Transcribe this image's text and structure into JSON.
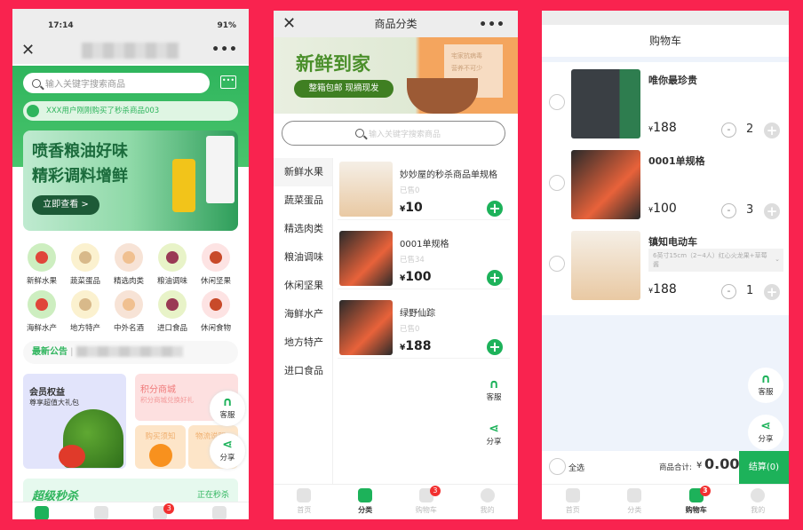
{
  "colors": {
    "background": "#f9234f",
    "brand_green": "#1db25a",
    "badge_red": "#f23030"
  },
  "home": {
    "status": {
      "time": "17:14",
      "battery": "91%"
    },
    "search_placeholder": "输入关键字搜索商品",
    "notice": "XXX用户刚刚购买了秒杀商品003",
    "banner": {
      "line1": "喷香粮油好味",
      "line2": "精彩调料增鲜",
      "cta": "立即查看 >"
    },
    "categories": [
      "新鲜水果",
      "蔬菜蛋品",
      "精选肉类",
      "粮油调味",
      "休闲坚果",
      "海鲜水产",
      "地方特产",
      "中外名酒",
      "进口食品",
      "休闲食物"
    ],
    "announcement_label": "最新公告",
    "member": {
      "title": "会员权益",
      "subtitle": "尊享超值大礼包"
    },
    "points": {
      "title": "积分商城",
      "subtitle": "积分商城兑换好礼"
    },
    "purchase_notice": "购买须知",
    "logistics": "物流说明",
    "flash": {
      "title": "超级秒杀",
      "status": "正在秒杀"
    },
    "cart_badge": "3"
  },
  "category_page": {
    "title": "商品分类",
    "banner": {
      "title": "新鲜到家",
      "subtitle": "整箱包邮 现摘现发",
      "side1": "宅家抗病毒",
      "side2": "营养不可少"
    },
    "search_placeholder": "输入关键字搜索商品",
    "sidebar": [
      "新鲜水果",
      "蔬菜蛋品",
      "精选肉类",
      "粮油调味",
      "休闲坚果",
      "海鲜水产",
      "地方特产",
      "进口食品"
    ],
    "products": [
      {
        "name": "妙妙屋的秒杀商品单规格",
        "sold": "已售0",
        "price": "10"
      },
      {
        "name": "0001单规格",
        "sold": "已售34",
        "price": "100"
      },
      {
        "name": "绿野仙踪",
        "sold": "已售0",
        "price": "188"
      }
    ]
  },
  "cart_page": {
    "title": "购物车",
    "items": [
      {
        "name": "唯你最珍贵",
        "price": "188",
        "qty": "2",
        "spec": ""
      },
      {
        "name": "0001单规格",
        "price": "100",
        "qty": "3",
        "spec": ""
      },
      {
        "name": "镇知电动车",
        "price": "188",
        "qty": "1",
        "spec": "6英寸15cm（2~4人）红心火龙果+草莓酱"
      }
    ],
    "select_all": "全选",
    "total_label": "商品合计:",
    "total_currency": "¥",
    "total": "0.00",
    "checkout": "结算(0)"
  },
  "common": {
    "currency": "¥",
    "service": "客服",
    "share": "分享",
    "tabs": [
      "首页",
      "分类",
      "购物车",
      "我的"
    ],
    "cart_badge": "3"
  }
}
